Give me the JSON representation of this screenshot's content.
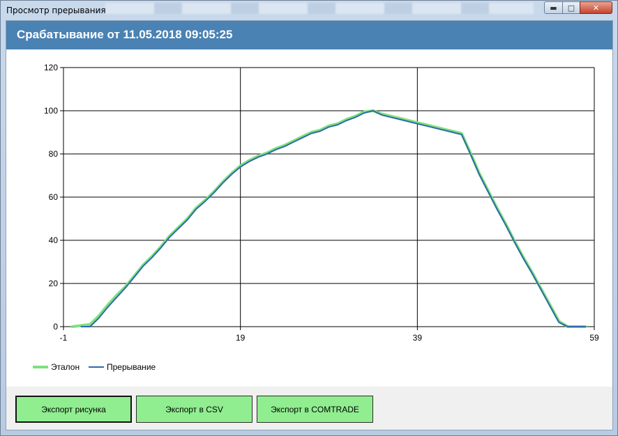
{
  "window": {
    "title": "Просмотр прерывания"
  },
  "header": {
    "title": "Срабатывание от 11.05.2018 09:05:25"
  },
  "footer": {
    "export_image_label": "Экспорт рисунка",
    "export_csv_label": "Экспорт в CSV",
    "export_comtrade_label": "Экспорт в COMTRADE"
  },
  "colors": {
    "header_bg": "#4a82b3",
    "etalon": "#7fe07f",
    "interruption": "#2e6aa8",
    "button_bg": "#90ee90"
  },
  "chart_data": {
    "type": "line",
    "title": "",
    "xlabel": "",
    "ylabel": "",
    "xlim": [
      -1,
      59
    ],
    "ylim": [
      0,
      120
    ],
    "x_ticks": [
      "-1",
      "19",
      "39",
      "59"
    ],
    "y_ticks": [
      "0",
      "20",
      "40",
      "60",
      "80",
      "100",
      "120"
    ],
    "grid": true,
    "legend_position": "bottom-left",
    "series": [
      {
        "name": "Эталон",
        "color": "#7fe07f",
        "x": [
          0,
          1,
          2,
          3,
          4,
          5,
          6,
          7,
          8,
          9,
          10,
          11,
          12,
          13,
          14,
          15,
          16,
          17,
          18,
          19,
          20,
          21,
          22,
          23,
          24,
          25,
          26,
          27,
          28,
          29,
          30,
          31,
          32,
          33,
          34,
          35,
          36,
          37,
          38,
          39,
          40,
          41,
          42,
          43,
          44,
          45,
          46,
          47,
          48,
          49,
          50,
          51,
          52,
          53,
          54,
          55,
          56,
          57,
          58
        ],
        "values": [
          0,
          0.5,
          1,
          5,
          10,
          14.5,
          18.5,
          23.5,
          28.5,
          32.5,
          37,
          42,
          46,
          50,
          55,
          58.5,
          62.5,
          67,
          71,
          74.5,
          77,
          79,
          80.5,
          82.5,
          84,
          86,
          88,
          90,
          91,
          93,
          94,
          96,
          97.5,
          99.5,
          100,
          98.5,
          97.5,
          96.5,
          95.5,
          94.5,
          93.5,
          92.5,
          91.5,
          90.5,
          89.5,
          80.5,
          71,
          63,
          55,
          47.5,
          39.5,
          32,
          25,
          17.5,
          10,
          2.5,
          0,
          0,
          0
        ]
      },
      {
        "name": "Прерывание",
        "color": "#2e6aa8",
        "x": [
          1,
          2,
          3,
          4,
          5,
          6,
          7,
          8,
          9,
          10,
          11,
          12,
          13,
          14,
          15,
          16,
          17,
          18,
          19,
          20,
          21,
          22,
          23,
          24,
          25,
          26,
          27,
          28,
          29,
          30,
          31,
          32,
          33,
          34,
          35,
          36,
          37,
          38,
          39,
          40,
          41,
          42,
          43,
          44,
          45,
          46,
          47,
          48,
          49,
          50,
          51,
          52,
          53,
          54,
          55,
          56,
          57,
          58
        ],
        "values": [
          0,
          0,
          4,
          9,
          13.5,
          18,
          23,
          28,
          32,
          36.5,
          41.5,
          45.5,
          49.5,
          54.5,
          58,
          62,
          66.5,
          70.5,
          74,
          76.5,
          78.5,
          80,
          82,
          83.5,
          85.5,
          87.5,
          89.5,
          90.5,
          92.5,
          93.5,
          95.5,
          97,
          99,
          100,
          98,
          97,
          96,
          95,
          94,
          93,
          92,
          91,
          90,
          89,
          80,
          70.5,
          62.5,
          54.5,
          47,
          39,
          31.5,
          24.5,
          17,
          9.5,
          2,
          0,
          0,
          0
        ]
      }
    ]
  }
}
